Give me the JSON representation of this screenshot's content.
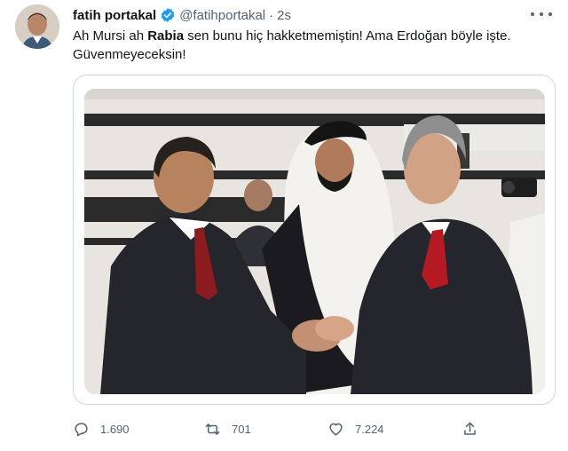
{
  "author": {
    "name": "fatih portakal",
    "handle": "@fatihportakal",
    "separator": "·",
    "time": "2s",
    "avatar_icon": "avatar-photo",
    "verified_color": "#1d9bf0"
  },
  "tweet": {
    "text_parts": [
      "Ah Mursi ah ",
      "Rabia",
      " sen bunu hiç hakketmemiştin! Ama Erdoğan böyle işte. Güvenmeyeceksin!"
    ]
  },
  "media": {
    "kind": "photo",
    "description_icon": "handshake-photo"
  },
  "actions": {
    "reply": {
      "icon": "reply-icon",
      "count": "1.690"
    },
    "retweet": {
      "icon": "retweet-icon",
      "count": "701"
    },
    "like": {
      "icon": "heart-icon",
      "count": "7.224"
    },
    "share": {
      "icon": "share-icon"
    }
  },
  "colors": {
    "text_secondary": "#536471",
    "border": "#cfd9de"
  }
}
